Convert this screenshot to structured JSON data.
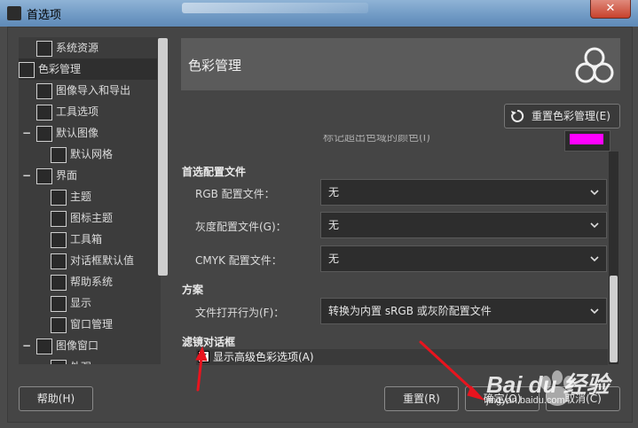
{
  "window": {
    "title": "首选项",
    "close_glyph": "✕"
  },
  "sidebar": {
    "items": [
      {
        "label": "系统资源",
        "icon": "chip-icon",
        "indent": 1
      },
      {
        "label": "色彩管理",
        "icon": "color-circles-icon",
        "indent": 1,
        "selected": true
      },
      {
        "label": "图像导入和导出",
        "icon": "import-export-icon",
        "indent": 1
      },
      {
        "label": "工具选项",
        "icon": "tool-options-icon",
        "indent": 1
      },
      {
        "label": "默认图像",
        "icon": "default-image-icon",
        "indent": 0,
        "expander": "−"
      },
      {
        "label": "默认网格",
        "icon": "grid-icon",
        "indent": 2
      },
      {
        "label": "界面",
        "icon": "interface-icon",
        "indent": 0,
        "expander": "−"
      },
      {
        "label": "主题",
        "icon": "theme-icon",
        "indent": 2
      },
      {
        "label": "图标主题",
        "icon": "icon-theme-icon",
        "indent": 2
      },
      {
        "label": "工具箱",
        "icon": "toolbox-icon",
        "indent": 2
      },
      {
        "label": "对话框默认值",
        "icon": "dialog-defaults-icon",
        "indent": 2
      },
      {
        "label": "帮助系统",
        "icon": "help-system-icon",
        "indent": 2
      },
      {
        "label": "显示",
        "icon": "display-icon",
        "indent": 2
      },
      {
        "label": "窗口管理",
        "icon": "window-management-icon",
        "indent": 2
      },
      {
        "label": "图像窗口",
        "icon": "image-window-icon",
        "indent": 0,
        "expander": "−"
      },
      {
        "label": "外观",
        "icon": "appearance-icon",
        "indent": 2
      }
    ]
  },
  "panel": {
    "title": "色彩管理",
    "reset_button": "重置色彩管理(E)",
    "cut_off_text": "标记超出色域的颜色(I)",
    "out_of_gamut_color": "#ff00ff",
    "preferred_profiles_heading": "首选配置文件",
    "rgb_label": "RGB 配置文件：",
    "rgb_value": "无",
    "gray_label": "灰度配置文件(G)：",
    "gray_value": "无",
    "cmyk_label": "CMYK 配置文件：",
    "cmyk_value": "无",
    "policy_heading": "方案",
    "file_open_label": "文件打开行为(F)：",
    "file_open_value": "转换为内置 sRGB 或灰阶配置文件",
    "filter_dialogs_heading": "滤镜对话框",
    "advanced_color_checkbox": "显示高级色彩选项(A)",
    "advanced_color_checked": true
  },
  "buttons": {
    "help": "帮助(H)",
    "reset": "重置(R)",
    "ok": "确定(O)",
    "cancel": "取消(C)"
  },
  "annotations": {
    "arrow_color": "#e8141e"
  },
  "watermark": {
    "brand": "Bai du 经验",
    "url": "jingyan.baidu.com"
  }
}
